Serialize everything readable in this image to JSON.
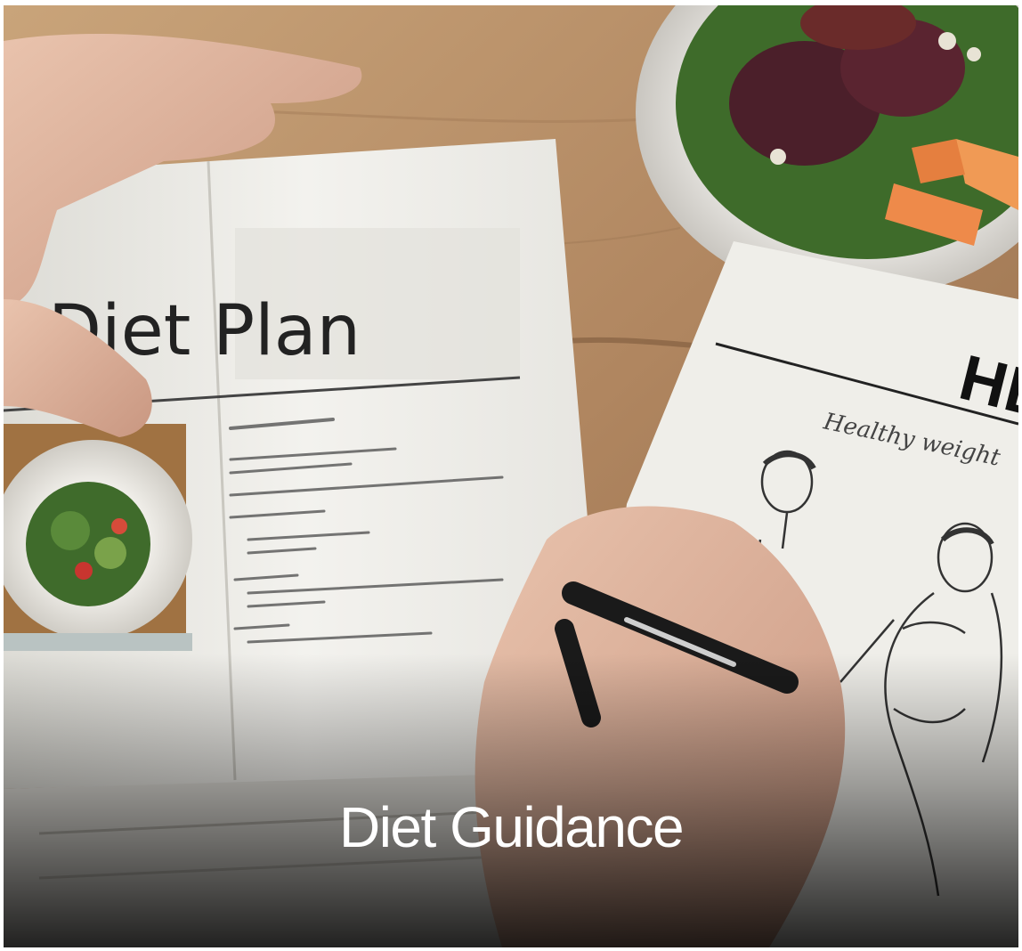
{
  "caption": "Diet Guidance",
  "photo": {
    "notebook_heading": "Diet Plan",
    "sheet_heading": "HE",
    "sheet_subheading": "Healthy weight"
  },
  "colors": {
    "table": "#b9946c",
    "paper": "#ecebe6",
    "caption_text": "#ffffff"
  }
}
